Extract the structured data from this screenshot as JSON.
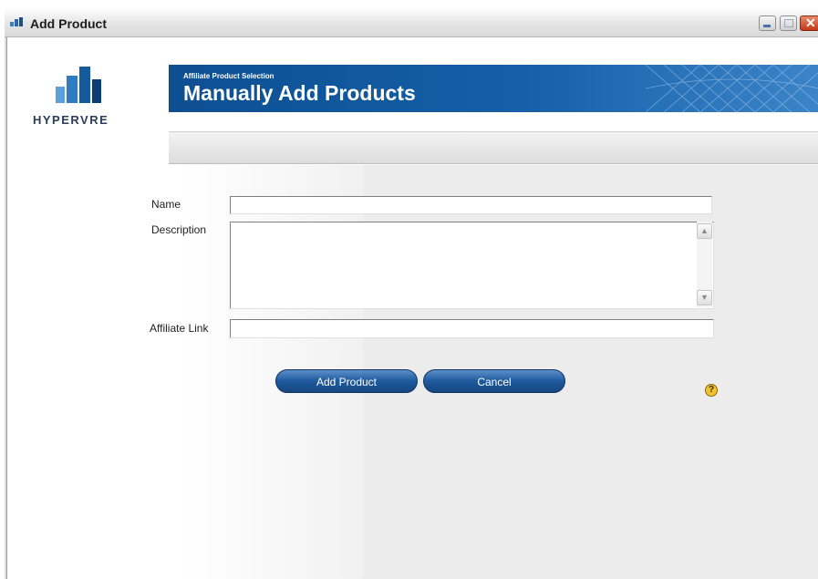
{
  "window": {
    "title": "Add Product",
    "close_glyph": "✕"
  },
  "header": {
    "logo_text": "HYPERVRE",
    "banner_subtitle": "Affiliate Product Selection",
    "banner_title": "Manually Add Products"
  },
  "form": {
    "name_label": "Name",
    "name_value": "",
    "description_label": "Description",
    "description_value": "",
    "affiliate_link_label": "Affiliate Link",
    "affiliate_link_value": "",
    "scroll_up_glyph": "▲",
    "scroll_down_glyph": "▼"
  },
  "actions": {
    "add_product_label": "Add Product",
    "cancel_label": "Cancel",
    "help_glyph": "?"
  },
  "colors": {
    "banner_blue": "#0d4f91",
    "button_blue": "#1e5a9e",
    "help_yellow": "#f1c232"
  },
  "icons": [
    "app-icon",
    "minimize-icon",
    "maximize-icon",
    "close-icon",
    "logo-icon",
    "help-icon",
    "scroll-up-icon",
    "scroll-down-icon"
  ]
}
